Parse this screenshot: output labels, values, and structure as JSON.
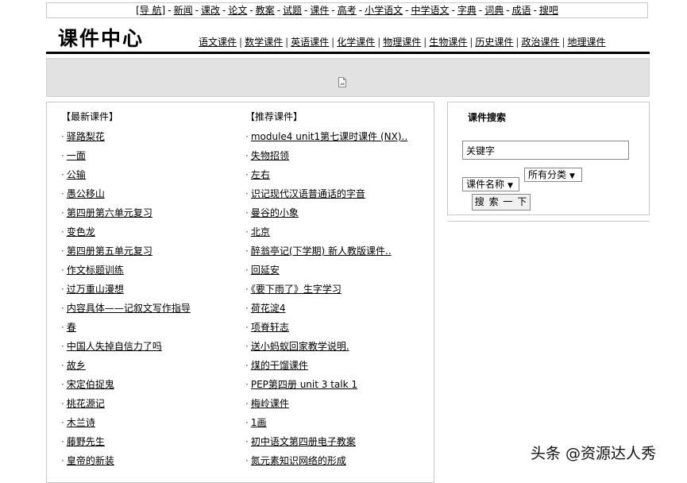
{
  "topnav": {
    "items": [
      "[导 航]",
      "新闻",
      "课改",
      "论文",
      "教案",
      "试题",
      "课件",
      "高考",
      "小学语文",
      "中学语文",
      "字典",
      "词典",
      "成语",
      "搜吧"
    ],
    "separator": "-"
  },
  "header": {
    "title": "课件中心",
    "subjects": [
      "语文课件",
      "数学课件",
      "英语课件",
      "化学课件",
      "物理课件",
      "生物课件",
      "历史课件",
      "政治课件",
      "地理课件"
    ],
    "subject_separator": "|"
  },
  "banner": {
    "icon": "broken-image-icon"
  },
  "latest": {
    "heading": "【最新课件】",
    "bullet": "·",
    "items": [
      "驿路梨花",
      "一面",
      "公输",
      "愚公移山",
      "第四册第六单元复习",
      "变色龙",
      "第四册第五单元复习",
      "作文标题训练",
      "过万重山漫想",
      "内容具体——记叙文写作指导",
      "春",
      "中国人失掉自信力了吗",
      "故乡",
      "宋定伯捉鬼",
      "桃花源记",
      "木兰诗",
      "藤野先生",
      "皇帝的新装"
    ]
  },
  "recommended": {
    "heading": "【推荐课件】",
    "bullet": "·",
    "items": [
      "module4 unit1第七课时课件 (NX)..",
      "失物招领",
      "左右",
      "识记现代汉语普通话的字音",
      "曼谷的小象",
      "北京",
      "醉翁亭记(下学期) 新人教版课件..",
      "回延安",
      "《要下雨了》生字学习",
      "荷花淀4",
      "项脊轩志",
      "送小蚂蚁回家教学说明.",
      "煤的干馏课件",
      "PEP第四册 unit 3 talk 1",
      "梅岭课件",
      "1画",
      "初中语文第四册电子教案",
      "氮元素知识网络的形成"
    ]
  },
  "search": {
    "title": "课件搜索",
    "keyword_value": "关键字",
    "field_select": "课件名称",
    "category_select": "所有分类",
    "button_label": "搜 索 一 下"
  },
  "watermark": "头条 @资源达人秀"
}
